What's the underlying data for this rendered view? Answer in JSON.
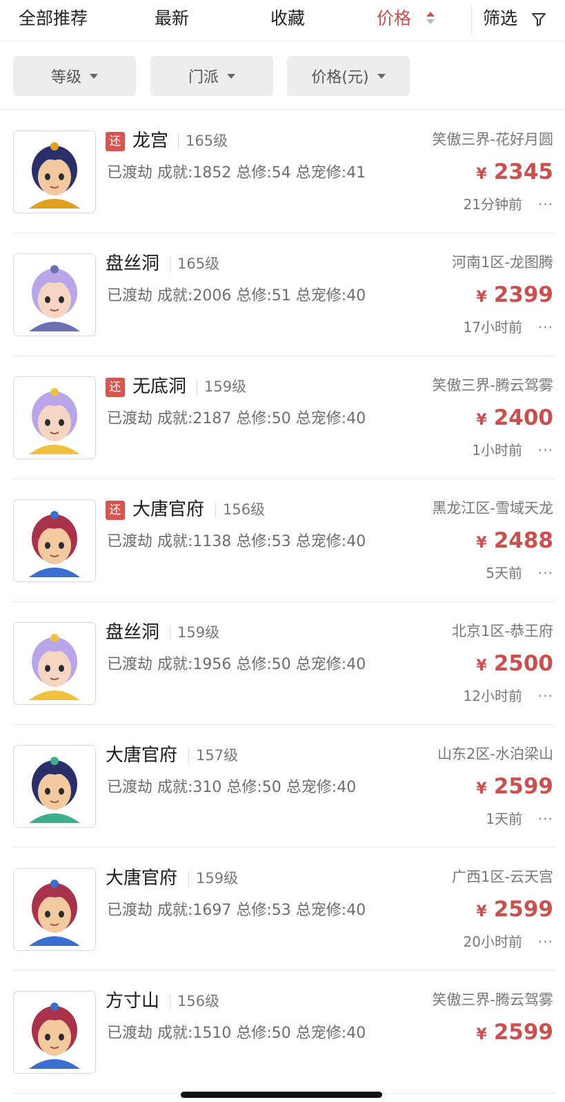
{
  "tabs": {
    "all": "全部推荐",
    "latest": "最新",
    "favorites": "收藏",
    "price": "价格",
    "filter": "筛选"
  },
  "filters": {
    "level": "等级",
    "school": "门派",
    "price": "价格(元)"
  },
  "currency_symbol": "¥",
  "listings": [
    {
      "school": "龙宫",
      "returned": "还",
      "level": "165级",
      "desc": "已渡劫 成就:1852 总修:54 总宠修:41",
      "server": "笑傲三界-花好月圆",
      "price": "2345",
      "time": "21分钟前",
      "more": "···"
    },
    {
      "school": "盘丝洞",
      "returned": "",
      "level": "165级",
      "desc": "已渡劫 成就:2006 总修:51 总宠修:40",
      "server": "河南1区-龙图腾",
      "price": "2399",
      "time": "17小时前",
      "more": "···"
    },
    {
      "school": "无底洞",
      "returned": "还",
      "level": "159级",
      "desc": "已渡劫 成就:2187 总修:50 总宠修:40",
      "server": "笑傲三界-腾云驾雾",
      "price": "2400",
      "time": "1小时前",
      "more": "···"
    },
    {
      "school": "大唐官府",
      "returned": "还",
      "level": "156级",
      "desc": "已渡劫 成就:1138 总修:53 总宠修:40",
      "server": "黑龙江区-雪域天龙",
      "price": "2488",
      "time": "5天前",
      "more": "···"
    },
    {
      "school": "盘丝洞",
      "returned": "",
      "level": "159级",
      "desc": "已渡劫 成就:1956 总修:50 总宠修:40",
      "server": "北京1区-恭王府",
      "price": "2500",
      "time": "12小时前",
      "more": "···"
    },
    {
      "school": "大唐官府",
      "returned": "",
      "level": "157级",
      "desc": "已渡劫 成就:310 总修:50 总宠修:40",
      "server": "山东2区-水泊梁山",
      "price": "2599",
      "time": "1天前",
      "more": "···"
    },
    {
      "school": "大唐官府",
      "returned": "",
      "level": "159级",
      "desc": "已渡劫 成就:1697 总修:53 总宠修:40",
      "server": "广西1区-云天宫",
      "price": "2599",
      "time": "20小时前",
      "more": "···"
    },
    {
      "school": "方寸山",
      "returned": "",
      "level": "156级",
      "desc": "已渡劫 成就:1510 总修:50 总宠修:40",
      "server": "笑傲三界-腾云驾雾",
      "price": "2599",
      "time": "",
      "more": ""
    }
  ],
  "avatar_styles": [
    {
      "hair": "#2a2f6a",
      "skin": "#f3c9a0",
      "accent": "#e0a020"
    },
    {
      "hair": "#b9a6e8",
      "skin": "#f6d6c2",
      "accent": "#6c6fb0"
    },
    {
      "hair": "#b9a6e8",
      "skin": "#f6d6c2",
      "accent": "#f0c040"
    },
    {
      "hair": "#a8324a",
      "skin": "#f3c9a0",
      "accent": "#3a6fd0"
    },
    {
      "hair": "#b9a6e8",
      "skin": "#f6d6c2",
      "accent": "#f0c040"
    },
    {
      "hair": "#2a2f6a",
      "skin": "#f3c9a0",
      "accent": "#3fae8a"
    },
    {
      "hair": "#a8324a",
      "skin": "#f3c9a0",
      "accent": "#3a6fd0"
    },
    {
      "hair": "#a8324a",
      "skin": "#f3c9a0",
      "accent": "#3a6fd0"
    }
  ],
  "colors": {
    "accent": "#c9504e",
    "badge": "#d9534f"
  }
}
